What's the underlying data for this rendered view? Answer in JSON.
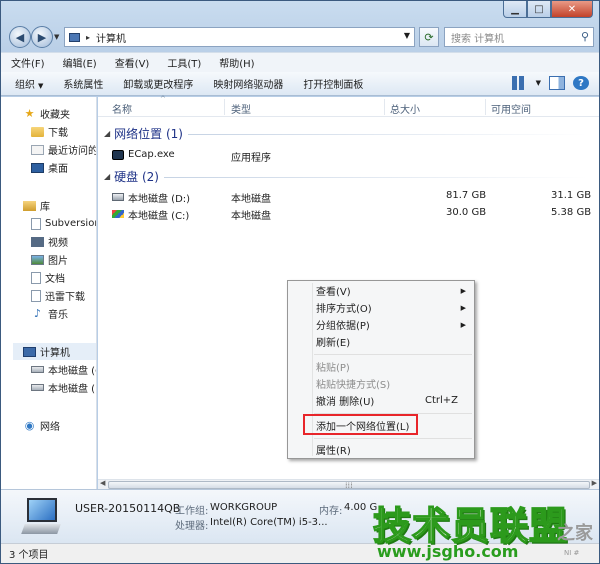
{
  "window": {
    "min": "▁",
    "max": "□",
    "close": "✕"
  },
  "address": {
    "location": "计算机",
    "arrow": "▸",
    "search_placeholder": "搜索 计算机"
  },
  "menubar": [
    "文件(F)",
    "编辑(E)",
    "查看(V)",
    "工具(T)",
    "帮助(H)"
  ],
  "cmdbar": {
    "organize": "组织",
    "items": [
      "系统属性",
      "卸载或更改程序",
      "映射网络驱动器",
      "打开控制面板"
    ]
  },
  "nav": {
    "favorites": "收藏夹",
    "fav_items": [
      "下载",
      "最近访问的",
      "桌面"
    ],
    "libraries": "库",
    "lib_items": [
      "Subversion",
      "视频",
      "图片",
      "文档",
      "迅雷下载",
      "音乐"
    ],
    "computer": "计算机",
    "drives": [
      "本地磁盘 (C",
      "本地磁盘 (D"
    ],
    "network": "网络"
  },
  "columns": {
    "name": "名称",
    "type": "类型",
    "total": "总大小",
    "free": "可用空间"
  },
  "groups": {
    "network": "网络位置 (1)",
    "disks": "硬盘 (2)"
  },
  "rows": [
    {
      "name": "ECap.exe",
      "type": "应用程序",
      "total": "",
      "free": ""
    },
    {
      "name": "本地磁盘 (D:)",
      "type": "本地磁盘",
      "total": "81.7 GB",
      "free": "31.1 GB"
    },
    {
      "name": "本地磁盘 (C:)",
      "type": "本地磁盘",
      "total": "30.0 GB",
      "free": "5.38 GB"
    }
  ],
  "context_menu": {
    "view": "查看(V)",
    "sort": "排序方式(O)",
    "group": "分组依据(P)",
    "refresh": "刷新(E)",
    "paste": "粘贴(P)",
    "paste_shortcut": "粘贴快捷方式(S)",
    "undo": "撤消 删除(U)",
    "undo_shortcut": "Ctrl+Z",
    "add_network": "添加一个网络位置(L)",
    "properties": "属性(R)"
  },
  "details": {
    "computer_name": "USER-20150114QB",
    "workgroup_label": "工作组:",
    "workgroup": "WORKGROUP",
    "memory_label": "内存:",
    "memory": "4.00 G",
    "cpu_label": "处理器:",
    "cpu": "Intel(R) Core(TM) i5-3..."
  },
  "status": "3 个项目",
  "watermark": {
    "main": "技术员联盟",
    "side": "之家",
    "url": "www.jsgho.com",
    "small": "NI #"
  }
}
